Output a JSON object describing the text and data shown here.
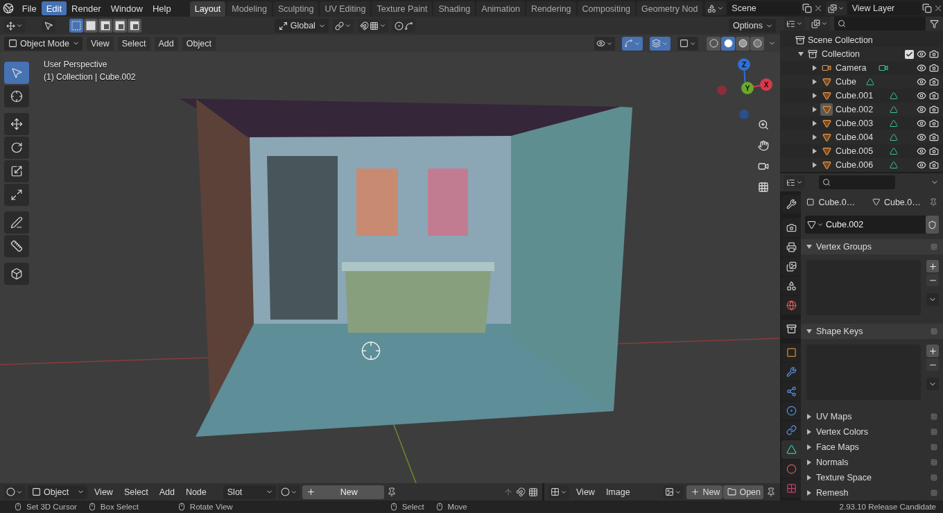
{
  "menu": [
    {
      "label": "File",
      "selected": false
    },
    {
      "label": "Edit",
      "selected": true
    },
    {
      "label": "Render",
      "selected": false
    },
    {
      "label": "Window",
      "selected": false
    },
    {
      "label": "Help",
      "selected": false
    }
  ],
  "workspaces": [
    {
      "label": "Layout",
      "selected": true
    },
    {
      "label": "Modeling",
      "selected": false
    },
    {
      "label": "Sculpting",
      "selected": false
    },
    {
      "label": "UV Editing",
      "selected": false
    },
    {
      "label": "Texture Paint",
      "selected": false
    },
    {
      "label": "Shading",
      "selected": false
    },
    {
      "label": "Animation",
      "selected": false
    },
    {
      "label": "Rendering",
      "selected": false
    },
    {
      "label": "Compositing",
      "selected": false
    },
    {
      "label": "Geometry Nod",
      "selected": false
    }
  ],
  "scene": "Scene",
  "view_layer": "View Layer",
  "tool_header": {
    "orientation": "Global",
    "options": "Options",
    "select_modes": [
      {
        "kind": "set",
        "selected": true
      },
      {
        "kind": "extend",
        "selected": false
      },
      {
        "kind": "subtract",
        "selected": false
      },
      {
        "kind": "difference",
        "selected": false
      },
      {
        "kind": "intersect",
        "selected": false
      }
    ]
  },
  "viewport_header": {
    "mode": "Object Mode",
    "menus": [
      "View",
      "Select",
      "Add",
      "Object"
    ],
    "toggles": [
      {
        "kind": "visibility",
        "on": false
      },
      {
        "kind": "gizmo",
        "on": true
      },
      {
        "kind": "overlay",
        "on": true
      },
      {
        "kind": "xray",
        "on": false
      }
    ],
    "shading": [
      {
        "kind": "wireframe",
        "selected": false
      },
      {
        "kind": "solid",
        "selected": true
      },
      {
        "kind": "material",
        "selected": false
      },
      {
        "kind": "rendered",
        "selected": false
      }
    ]
  },
  "viewport": {
    "perspective": "User Perspective",
    "context": "(1) Collection | Cube.002",
    "gizmo_axes": [
      {
        "label": "Z",
        "color": "#2f6fd6"
      },
      {
        "label": "Y",
        "color": "#6aa82a"
      },
      {
        "label": "X",
        "color": "#d8394b"
      }
    ]
  },
  "toolbar": [
    {
      "kind": "select",
      "selected": true
    },
    {
      "kind": "cursor",
      "selected": false
    },
    {
      "kind": "move",
      "selected": false
    },
    {
      "kind": "rotate",
      "selected": false
    },
    {
      "kind": "scale",
      "selected": false
    },
    {
      "kind": "transform",
      "selected": false
    },
    {
      "kind": "annotate",
      "selected": false
    },
    {
      "kind": "measure",
      "selected": false
    },
    {
      "kind": "add_cube",
      "selected": false
    }
  ],
  "outliner": {
    "root": "Scene Collection",
    "collection": {
      "label": "Collection",
      "expanded": true,
      "checked": true,
      "children": [
        {
          "label": "Camera",
          "kind": "camera",
          "selected": false,
          "expanded": false
        },
        {
          "label": "Cube",
          "kind": "mesh",
          "selected": false,
          "expanded": false
        },
        {
          "label": "Cube.001",
          "kind": "mesh",
          "selected": false,
          "expanded": false
        },
        {
          "label": "Cube.002",
          "kind": "mesh",
          "selected": true,
          "expanded": false
        },
        {
          "label": "Cube.003",
          "kind": "mesh",
          "selected": false,
          "expanded": false
        },
        {
          "label": "Cube.004",
          "kind": "mesh",
          "selected": false,
          "expanded": false
        },
        {
          "label": "Cube.005",
          "kind": "mesh",
          "selected": false,
          "expanded": false
        },
        {
          "label": "Cube.006",
          "kind": "mesh",
          "selected": false,
          "expanded": false
        }
      ]
    }
  },
  "properties": {
    "tabs": [
      {
        "kind": "tool",
        "selected": false
      },
      {
        "kind": "render",
        "selected": false
      },
      {
        "kind": "output",
        "selected": false
      },
      {
        "kind": "view_layer",
        "selected": false
      },
      {
        "kind": "scene",
        "selected": false
      },
      {
        "kind": "world",
        "selected": false
      },
      {
        "kind": "collection",
        "selected": false
      },
      {
        "kind": "object",
        "selected": false
      },
      {
        "kind": "modifiers",
        "selected": false
      },
      {
        "kind": "particles",
        "selected": false
      },
      {
        "kind": "physics",
        "selected": false
      },
      {
        "kind": "constraints",
        "selected": false
      },
      {
        "kind": "data",
        "selected": true
      },
      {
        "kind": "material",
        "selected": false
      },
      {
        "kind": "texture",
        "selected": false
      }
    ],
    "breadcrumb": [
      "Cube.0…",
      "Cube.0…"
    ],
    "mesh_name": "Cube.002",
    "panels": [
      {
        "title": "Vertex Groups",
        "expanded": true
      },
      {
        "title": "Shape Keys",
        "expanded": true
      },
      {
        "title": "UV Maps",
        "expanded": false
      },
      {
        "title": "Vertex Colors",
        "expanded": false
      },
      {
        "title": "Face Maps",
        "expanded": false
      },
      {
        "title": "Normals",
        "expanded": false
      },
      {
        "title": "Texture Space",
        "expanded": false
      },
      {
        "title": "Remesh",
        "expanded": false
      }
    ]
  },
  "shader_header": {
    "mode": "Object",
    "menus": [
      "View",
      "Select",
      "Add",
      "Node"
    ],
    "slot": "Slot",
    "new_label": "New"
  },
  "image_header": {
    "menus": [
      "View",
      "Image"
    ],
    "new_label": "New",
    "open_label": "Open"
  },
  "status_bar": {
    "hints": [
      "Set 3D Cursor",
      "Box Select",
      "Rotate View",
      "Select",
      "Move"
    ],
    "version": "2.93.10 Release Candidate"
  }
}
